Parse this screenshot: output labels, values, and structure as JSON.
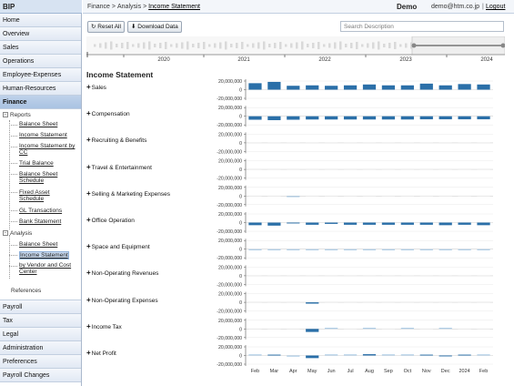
{
  "app": {
    "title": "BIP"
  },
  "nav": {
    "top_items": [
      "Home",
      "Overview",
      "Sales",
      "Operations",
      "Employee-Expenses",
      "Human-Resources",
      "Finance"
    ],
    "active": "Finance",
    "bottom_items": [
      "Payroll",
      "Tax",
      "Legal",
      "Administration",
      "Preferences",
      "Payroll Changes"
    ]
  },
  "tree": {
    "reports_label": "Reports",
    "reports": [
      "Balance Sheet",
      "Income Statement",
      "Income Statement by CC",
      "Trial Balance",
      "Balance Sheet Schedule",
      "Fixed Asset Schedule",
      "GL Transactions",
      "Bank Statement"
    ],
    "analysis_label": "Analysis",
    "analysis": [
      "Balance Sheet",
      "Income Statement",
      "by Vendor and Cost Center"
    ],
    "selected": "Income Statement",
    "references_label": "References"
  },
  "header": {
    "breadcrumb": [
      "Finance",
      "Analysis",
      "Income Statement"
    ],
    "org": "Demo",
    "user_email": "demo@htm.co.jp",
    "separator": "|",
    "logout": "Logout"
  },
  "toolbar": {
    "reset_label": "Reset All",
    "download_label": "Download Data",
    "search_placeholder": "Search Description"
  },
  "timeline": {
    "years": [
      "2020",
      "2021",
      "2022",
      "2023",
      "2024"
    ]
  },
  "page_title": "Income Statement",
  "chart_data": {
    "type": "bar",
    "title": "Income Statement",
    "categories": [
      "Feb",
      "Mar",
      "Apr",
      "May",
      "Jun",
      "Jul",
      "Aug",
      "Sep",
      "Oct",
      "Nov",
      "Dec",
      "2024",
      "Feb"
    ],
    "ylim": [
      -20000000,
      20000000
    ],
    "y_ticks": [
      "20,000,000",
      "0",
      "-20,000,000"
    ],
    "series": [
      {
        "name": "Sales",
        "values": [
          15000000,
          18000000,
          9000000,
          10000000,
          9000000,
          10000000,
          12000000,
          10000000,
          10000000,
          14000000,
          10000000,
          13000000,
          12000000
        ]
      },
      {
        "name": "Compensation",
        "values": [
          -8000000,
          -9000000,
          -8000000,
          -7500000,
          -7500000,
          -7500000,
          -7500000,
          -7500000,
          -7500000,
          -7000000,
          -7000000,
          -7000000,
          -7000000
        ]
      },
      {
        "name": "Recruiting & Benefits",
        "values": [
          0,
          0,
          0,
          0,
          0,
          0,
          0,
          0,
          0,
          0,
          0,
          0,
          0
        ]
      },
      {
        "name": "Travel & Entertainment",
        "values": [
          0,
          0,
          0,
          0,
          0,
          0,
          0,
          0,
          0,
          0,
          0,
          0,
          0
        ]
      },
      {
        "name": "Selling & Marketing Expenses",
        "values": [
          0,
          0,
          -500000,
          0,
          0,
          0,
          0,
          0,
          0,
          0,
          0,
          0,
          0
        ]
      },
      {
        "name": "Office Operation",
        "values": [
          -6000000,
          -7000000,
          -2000000,
          -5000000,
          -3000000,
          -5000000,
          -5000000,
          -5000000,
          -5000000,
          -5000000,
          -6000000,
          -5000000,
          -6000000
        ]
      },
      {
        "name": "Space and Equipment",
        "values": [
          -1000000,
          -1000000,
          -1000000,
          -1000000,
          -1000000,
          -1000000,
          -1000000,
          -1000000,
          -1000000,
          -1000000,
          -1000000,
          -1000000,
          -1000000
        ]
      },
      {
        "name": "Non-Operating Revenues",
        "values": [
          0,
          0,
          0,
          0,
          0,
          0,
          0,
          0,
          0,
          0,
          0,
          0,
          0
        ]
      },
      {
        "name": "Non-Operating Expenses",
        "values": [
          0,
          0,
          0,
          -3000000,
          0,
          0,
          0,
          0,
          0,
          0,
          0,
          0,
          0
        ]
      },
      {
        "name": "Income Tax",
        "values": [
          0,
          0,
          0,
          -7000000,
          1000000,
          0,
          1000000,
          0,
          1000000,
          0,
          1500000,
          0,
          0
        ]
      },
      {
        "name": "Net Profit",
        "values": [
          1500000,
          2000000,
          -1000000,
          -6000000,
          1000000,
          1000000,
          3000000,
          1000000,
          1000000,
          2000000,
          -2000000,
          2000000,
          1500000
        ]
      }
    ],
    "colors": {
      "bar": "#2a6fa8",
      "bar_light": "#a9c9e3",
      "zero_line": "#cfcfcf",
      "grid": "#e8e8e8"
    },
    "grid": true,
    "legend": "none"
  }
}
